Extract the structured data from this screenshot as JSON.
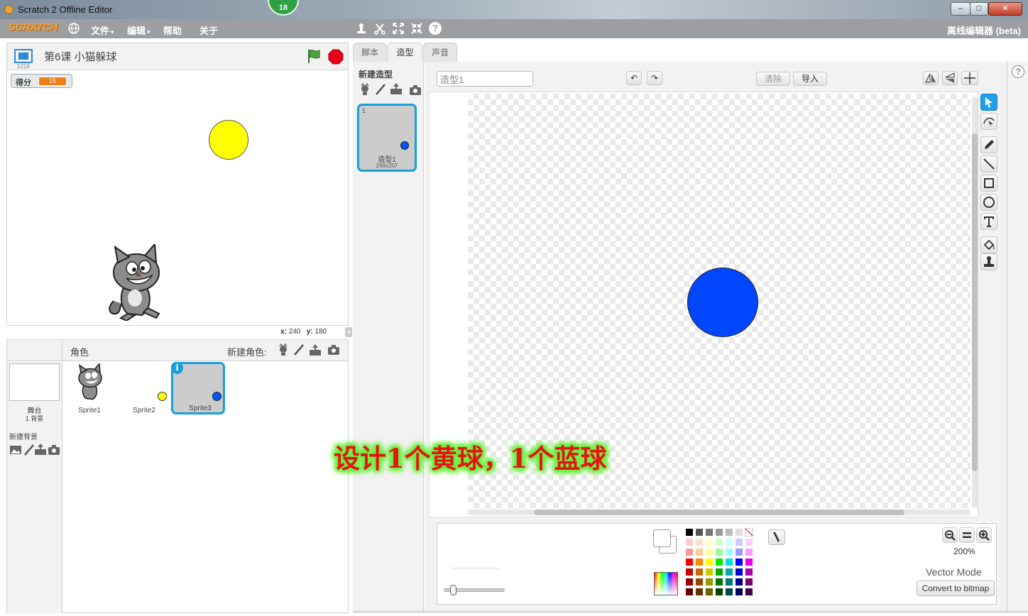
{
  "window": {
    "title": "Scratch 2 Offline Editor",
    "badge": "18",
    "min_glyph": "–",
    "max_glyph": "□",
    "close_glyph": "✕"
  },
  "menubar": {
    "logo": "SCRATCH",
    "items": {
      "file": "文件",
      "edit": "编辑",
      "help": "帮助",
      "about": "关于"
    },
    "dropdown_glyph": "▾",
    "help_glyph": "?",
    "offline_label": "离线编辑器 (beta)"
  },
  "stage": {
    "version": "1219",
    "project_title": "第6课  小猫躲球",
    "monitor": {
      "label": "得分",
      "value": "15"
    },
    "coords": {
      "x_label": "x:",
      "x": "240",
      "y_label": "y:",
      "y": "180"
    },
    "collapse_glyph": "◂"
  },
  "sprites_panel": {
    "title": "角色",
    "new_sprite_label": "新建角色:",
    "stage_name": "舞台",
    "stage_backdrops": "1 背景",
    "new_backdrop_label": "新建背景",
    "info_glyph": "i",
    "sprites": [
      {
        "name": "Sprite1"
      },
      {
        "name": "Sprite2"
      },
      {
        "name": "Sprite3"
      }
    ]
  },
  "tabs": {
    "scripts": "脚本",
    "costumes": "造型",
    "sounds": "声音"
  },
  "costumes": {
    "new_label": "新建造型",
    "items": [
      {
        "number": "1",
        "name": "造型1",
        "size": "268x207"
      }
    ]
  },
  "editor": {
    "name_value": "造型1",
    "undo_glyph": "↶",
    "redo_glyph": "↷",
    "clear_label": "清除",
    "import_label": "导入",
    "zoom_level": "200%",
    "mode_label": "Vector Mode",
    "convert_label": "Convert to bitmap",
    "help_glyph": "?"
  },
  "palette_colors": [
    [
      "#000000",
      "#555555",
      "#777777",
      "#999999",
      "#bbbbbb",
      "#dddddd",
      "#ffffff"
    ],
    [
      "#ffcccc",
      "#ffe0cc",
      "#ffffcc",
      "#ccffcc",
      "#ccffff",
      "#ccccff",
      "#ffccff"
    ],
    [
      "#ff9999",
      "#ffcc99",
      "#ffff99",
      "#99ff99",
      "#99ffff",
      "#9999ff",
      "#ff99ff"
    ],
    [
      "#ff0000",
      "#ff8800",
      "#ffff00",
      "#00ee00",
      "#00dddd",
      "#0000ff",
      "#ee00ee"
    ],
    [
      "#cc0000",
      "#cc6600",
      "#cccc00",
      "#00aa00",
      "#00aaaa",
      "#0000cc",
      "#aa00aa"
    ],
    [
      "#990000",
      "#994400",
      "#999900",
      "#007700",
      "#007777",
      "#000099",
      "#770077"
    ],
    [
      "#660000",
      "#663300",
      "#666600",
      "#004400",
      "#004444",
      "#000066",
      "#440044"
    ]
  ],
  "caption": "设计1个黄球，1个蓝球"
}
